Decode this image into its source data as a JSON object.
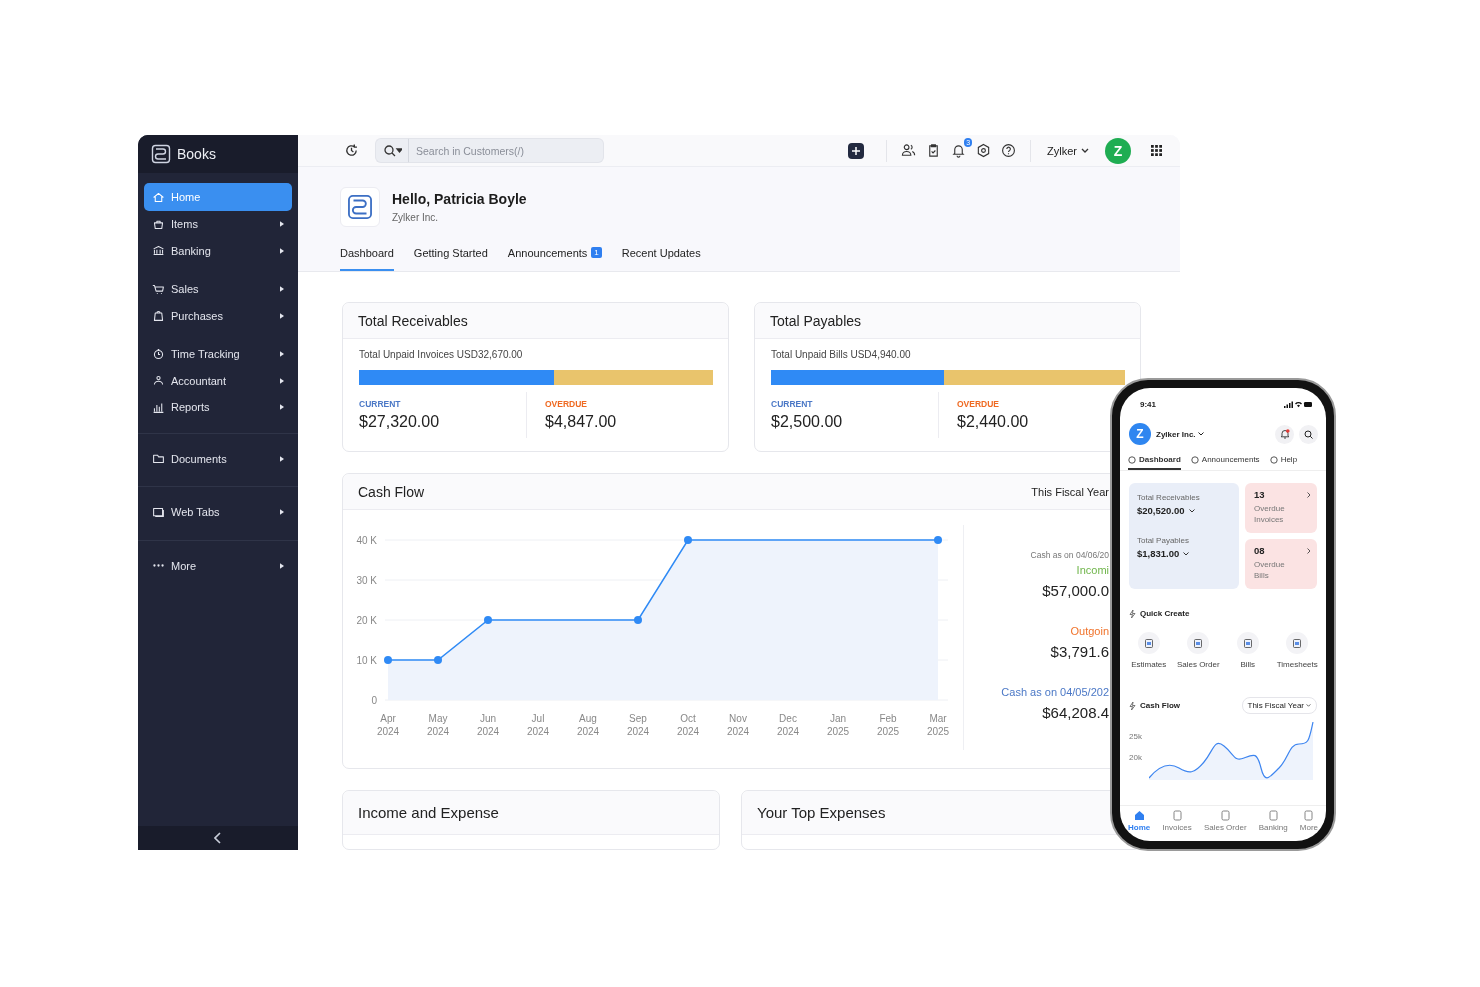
{
  "sidebar": {
    "brand": "Books",
    "groups": [
      {
        "divider": false,
        "items": [
          {
            "label": "Home",
            "selected": true,
            "has_submenu": false
          },
          {
            "label": "Items",
            "selected": false,
            "has_submenu": true
          },
          {
            "label": "Banking",
            "selected": false,
            "has_submenu": true
          }
        ]
      },
      {
        "divider": false,
        "items": [
          {
            "label": "Sales",
            "selected": false,
            "has_submenu": true
          },
          {
            "label": "Purchases",
            "selected": false,
            "has_submenu": true
          }
        ]
      },
      {
        "divider": false,
        "items": [
          {
            "label": "Time Tracking",
            "selected": false,
            "has_submenu": true
          },
          {
            "label": "Accountant",
            "selected": false,
            "has_submenu": true
          },
          {
            "label": "Reports",
            "selected": false,
            "has_submenu": true
          }
        ]
      },
      {
        "divider": true,
        "items": [
          {
            "label": "Documents",
            "selected": false,
            "has_submenu": true
          }
        ]
      },
      {
        "divider": true,
        "items": [
          {
            "label": "Web Tabs",
            "selected": false,
            "has_submenu": true
          }
        ]
      },
      {
        "divider": true,
        "items": [
          {
            "label": "More",
            "selected": false,
            "has_submenu": true
          }
        ]
      }
    ]
  },
  "header": {
    "search": {
      "placeholder": "Search in Customers(/)"
    },
    "notification_count": "3",
    "organization": "Zylker",
    "avatar": "Z"
  },
  "greeting": {
    "title": "Hello, Patricia Boyle",
    "subtitle": "Zylker Inc."
  },
  "tabs": [
    {
      "label": "Dashboard",
      "selected": true
    },
    {
      "label": "Getting Started",
      "selected": false
    },
    {
      "label": "Announcements",
      "badge": "1",
      "selected": false
    },
    {
      "label": "Recent Updates",
      "selected": false
    }
  ],
  "summary_cards": [
    {
      "title": "Total Receivables",
      "subtitle": "Total Unpaid Invoices USD32,670.00",
      "level": 0.55,
      "current_label": "CURRENT",
      "current": "$27,320.00",
      "overdue_label": "OVERDUE",
      "overdue": "$4,847.00"
    },
    {
      "title": "Total Payables",
      "subtitle": "Total Unpaid Bills USD4,940.00",
      "level": 0.49,
      "current_label": "CURRENT",
      "current": "$2,500.00",
      "overdue_label": "OVERDUE",
      "overdue": "$2,440.00"
    }
  ],
  "cash_flow": {
    "title": "Cash Flow",
    "period": "This Fiscal Year",
    "chart_data": {
      "type": "area",
      "categories": [
        "Apr 2024",
        "May 2024",
        "Jun 2024",
        "Jul 2024",
        "Aug 2024",
        "Sep 2024",
        "Oct 2024",
        "Nov 2024",
        "Dec 2024",
        "Jan 2025",
        "Feb 2025",
        "Mar 2025"
      ],
      "grid": true,
      "series": [
        {
          "color": "#2f8af5",
          "values": [
            10000,
            10000,
            20000,
            null,
            null,
            20000,
            40000,
            null,
            null,
            null,
            null,
            40000
          ]
        }
      ],
      "ylim": [
        0,
        40000
      ],
      "yticks": [
        {
          "value": 0,
          "label": "0"
        },
        {
          "value": 10000,
          "label": "10 K"
        },
        {
          "value": 20000,
          "label": "20 K"
        },
        {
          "value": 30000,
          "label": "30 K"
        },
        {
          "value": 40000,
          "label": "40 K"
        }
      ]
    },
    "summary": {
      "opening_label": "Cash as on 04/06/20",
      "incoming_label": "Incomi",
      "incoming": "$57,000.0",
      "outgoing_label": "Outgoin",
      "outgoing": "$3,791.6",
      "closing_label": "Cash as on 04/05/202",
      "closing": "$64,208.4"
    }
  },
  "bottom_cards": [
    "Income and Expense",
    "Your Top Expenses"
  ],
  "phone": {
    "time": "9:41",
    "avatar": "Z",
    "organization": "Zylker Inc.",
    "tabs": [
      {
        "label": "Dashboard",
        "selected": true
      },
      {
        "label": "Announcements",
        "selected": false
      },
      {
        "label": "Help",
        "selected": false
      }
    ],
    "totals": [
      {
        "label": "Total Receivables",
        "amount": "$20,520.00"
      },
      {
        "label": "Total Payables",
        "amount": "$1,831.00"
      }
    ],
    "overdue": [
      {
        "count": "13",
        "label": "Overdue Invoices"
      },
      {
        "count": "08",
        "label": "Overdue Bills"
      }
    ],
    "quick_create_title": "Quick Create",
    "quick_create": [
      "Estimates",
      "Sales Order",
      "Bills",
      "Timesheets"
    ],
    "cash_flow_title": "Cash Flow",
    "period": "This Fiscal Year",
    "axis_labels": [
      "25k",
      "20k"
    ],
    "nav": [
      {
        "label": "Home",
        "selected": true
      },
      {
        "label": "Invoices",
        "selected": false
      },
      {
        "label": "Sales Order",
        "selected": false
      },
      {
        "label": "Banking",
        "selected": false
      },
      {
        "label": "More",
        "selected": false
      }
    ]
  }
}
